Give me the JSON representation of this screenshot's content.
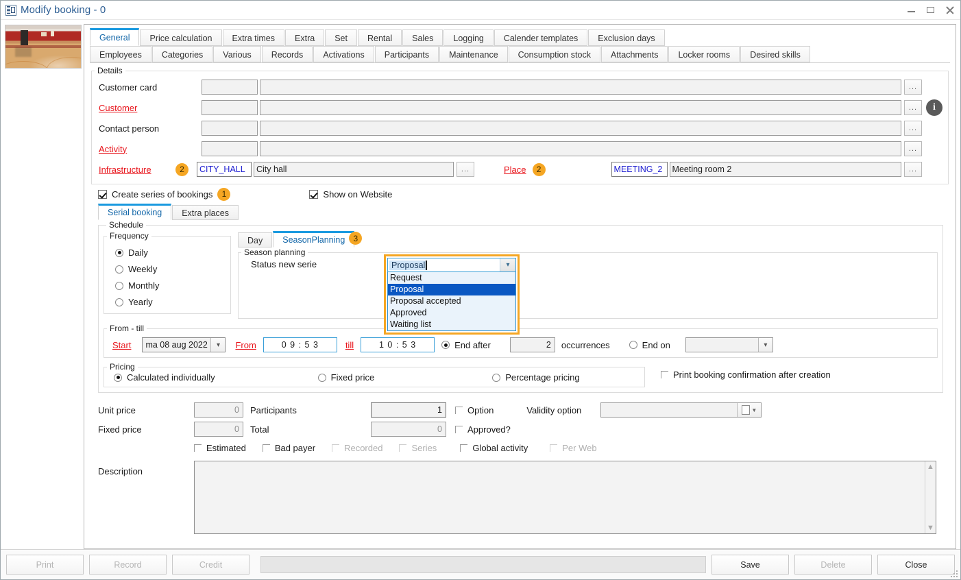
{
  "window": {
    "title": "Modify booking - 0",
    "icon": "booking-window-icon",
    "minimize": "minimize-icon",
    "maximize": "maximize-icon",
    "close": "close-icon"
  },
  "thumbnail": {
    "alt": "sports hall photo"
  },
  "tabs_row1": [
    {
      "label": "General",
      "active": true
    },
    {
      "label": "Price calculation",
      "active": false
    },
    {
      "label": "Extra times",
      "active": false
    },
    {
      "label": "Extra",
      "active": false
    },
    {
      "label": "Set",
      "active": false
    },
    {
      "label": "Rental",
      "active": false
    },
    {
      "label": "Sales",
      "active": false
    },
    {
      "label": "Logging",
      "active": false
    },
    {
      "label": "Calender templates",
      "active": false
    },
    {
      "label": "Exclusion days",
      "active": false
    }
  ],
  "tabs_row2": [
    {
      "label": "Employees"
    },
    {
      "label": "Categories"
    },
    {
      "label": "Various"
    },
    {
      "label": "Records"
    },
    {
      "label": "Activations"
    },
    {
      "label": "Participants"
    },
    {
      "label": "Maintenance"
    },
    {
      "label": "Consumption stock"
    },
    {
      "label": "Attachments"
    },
    {
      "label": "Locker rooms"
    },
    {
      "label": "Desired skills"
    }
  ],
  "details": {
    "legend": "Details",
    "rows": [
      {
        "label": "Customer card",
        "required": false,
        "code": "",
        "value": ""
      },
      {
        "label": "Customer",
        "required": true,
        "code": "",
        "value": ""
      },
      {
        "label": "Contact person",
        "required": false,
        "code": "",
        "value": ""
      },
      {
        "label": "Activity",
        "required": true,
        "code": "",
        "value": ""
      }
    ],
    "infrastructure": {
      "label": "Infrastructure",
      "badge": "2",
      "code": "CITY_HALL",
      "value": "City hall"
    },
    "place": {
      "label": "Place",
      "badge": "2",
      "code": "MEETING_2",
      "value": "Meeting room 2"
    },
    "dots": "...",
    "info_icon": "info-icon"
  },
  "checkboxes_top": {
    "create_series": {
      "label": "Create series of bookings",
      "checked": true,
      "badge": "1"
    },
    "show_on_website": {
      "label": "Show on Website",
      "checked": true
    }
  },
  "serial_tabs": [
    {
      "label": "Serial booking",
      "active": true
    },
    {
      "label": "Extra places",
      "active": false
    }
  ],
  "schedule": {
    "legend": "Schedule",
    "frequency": {
      "legend": "Frequency",
      "options": [
        {
          "label": "Daily",
          "selected": true
        },
        {
          "label": "Weekly",
          "selected": false
        },
        {
          "label": "Monthly",
          "selected": false
        },
        {
          "label": "Yearly",
          "selected": false
        }
      ]
    },
    "inner_tabs": [
      {
        "label": "Day",
        "active": false
      },
      {
        "label": "SeasonPlanning",
        "active": true,
        "badge": "3"
      }
    ],
    "season_planning": {
      "legend": "Season planning",
      "field_label": "Status new serie",
      "combo": {
        "value": "Proposal",
        "arrow": "chevron-down-icon",
        "options": [
          {
            "label": "Request",
            "selected": false
          },
          {
            "label": "Proposal",
            "selected": true
          },
          {
            "label": "Proposal accepted",
            "selected": false
          },
          {
            "label": "Approved",
            "selected": false
          },
          {
            "label": "Waiting list",
            "selected": false
          }
        ]
      }
    },
    "from_till": {
      "legend": "From - till",
      "start_label": "Start",
      "start_date": "ma 08 aug 2022",
      "from_label": "From",
      "from_time": "0 9 : 5 3",
      "till_label": "till",
      "till_time": "1 0 : 5 3",
      "end_after": {
        "label": "End after",
        "selected": true
      },
      "occurrences_value": "2",
      "occurrences_label": "occurrences",
      "end_on": {
        "label": "End on",
        "selected": false
      },
      "end_on_value": ""
    },
    "pricing": {
      "legend": "Pricing",
      "options": [
        {
          "label": "Calculated individually",
          "selected": true
        },
        {
          "label": "Fixed price",
          "selected": false
        },
        {
          "label": "Percentage pricing",
          "selected": false
        }
      ],
      "print_confirmation": {
        "label": "Print booking confirmation after creation",
        "checked": false
      }
    }
  },
  "bottom": {
    "unit_price_label": "Unit price",
    "unit_price_value": "0",
    "participants_label": "Participants",
    "participants_value": "1",
    "option_label": "Option",
    "option_checked": false,
    "validity_option_label": "Validity option",
    "validity_option_value": "",
    "validity_icon": "calculator-icon",
    "fixed_price_label": "Fixed price",
    "fixed_price_value": "0",
    "total_label": "Total",
    "total_value": "0",
    "approved_label": "Approved?",
    "approved_checked": false,
    "flags": [
      {
        "label": "Estimated",
        "checked": false,
        "disabled": false
      },
      {
        "label": "Bad payer",
        "checked": false,
        "disabled": false
      },
      {
        "label": "Recorded",
        "checked": false,
        "disabled": true
      },
      {
        "label": "Series",
        "checked": false,
        "disabled": true
      },
      {
        "label": "Global activity",
        "checked": false,
        "disabled": false
      },
      {
        "label": "Per Web",
        "checked": false,
        "disabled": true
      }
    ],
    "description_label": "Description",
    "description_value": "",
    "scroll_up": "scroll-up-icon",
    "scroll_down": "scroll-down-icon"
  },
  "footer": {
    "print": {
      "label": "Print",
      "enabled": false
    },
    "record": {
      "label": "Record",
      "enabled": false
    },
    "credit": {
      "label": "Credit",
      "enabled": false
    },
    "save": {
      "label": "Save",
      "enabled": true
    },
    "delete": {
      "label": "Delete",
      "enabled": false
    },
    "close": {
      "label": "Close",
      "enabled": true
    }
  },
  "colors": {
    "accent": "#1a9ae0",
    "required": "#e8131a",
    "badge": "#f5a623",
    "highlight": "#0a57c2",
    "focus": "#f5a623"
  }
}
